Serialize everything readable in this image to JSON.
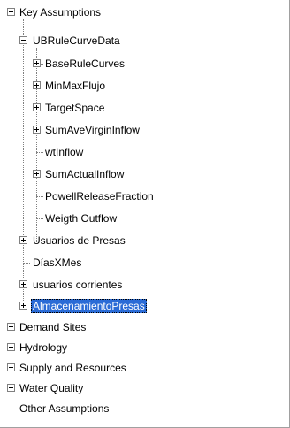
{
  "tree": {
    "root": {
      "label": "Key Assumptions",
      "expanded": true,
      "children": {
        "ubrule": {
          "label": "UBRuleCurveData",
          "expanded": true,
          "children": [
            {
              "label": "BaseRuleCurves",
              "expandable": true
            },
            {
              "label": "MinMaxFlujo",
              "expandable": true
            },
            {
              "label": "TargetSpace",
              "expandable": true
            },
            {
              "label": "SumAveVirginInflow",
              "expandable": true
            },
            {
              "label": "wtInflow",
              "expandable": false
            },
            {
              "label": "SumActualInflow",
              "expandable": true
            },
            {
              "label": "PowellReleaseFraction",
              "expandable": false
            },
            {
              "label": "Weigth Outflow",
              "expandable": false
            }
          ]
        },
        "usuarios_presas": {
          "label": "Usuarios de Presas",
          "expandable": true
        },
        "dias_mes": {
          "label": "DíasXMes",
          "expandable": false
        },
        "usuarios_corrientes": {
          "label": "usuarios corrientes",
          "expandable": true
        },
        "almacenamiento": {
          "label": "AlmacenamientoPresas",
          "expandable": true,
          "selected": true
        }
      }
    },
    "top_level": [
      {
        "label": "Demand Sites",
        "expandable": true
      },
      {
        "label": "Hydrology",
        "expandable": true
      },
      {
        "label": "Supply and Resources",
        "expandable": true
      },
      {
        "label": "Water Quality",
        "expandable": true
      },
      {
        "label": "Other Assumptions",
        "expandable": false
      }
    ]
  },
  "colors": {
    "selection": "#2a6bd6",
    "connector": "#808080"
  }
}
